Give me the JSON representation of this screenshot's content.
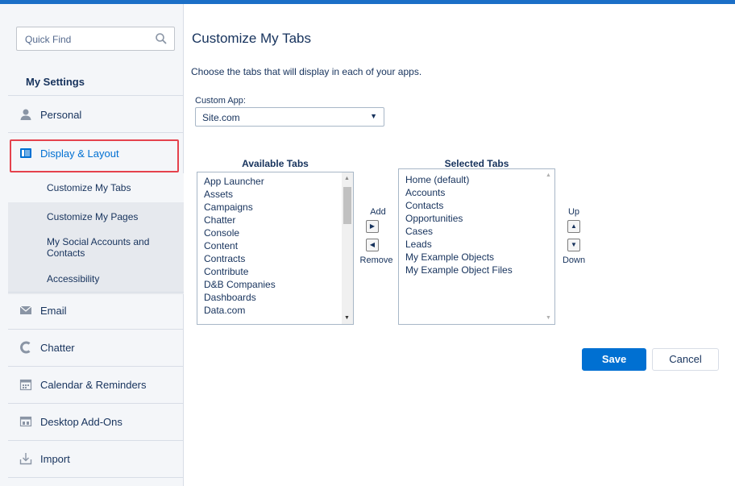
{
  "sidebar": {
    "quick_find_placeholder": "Quick Find",
    "title": "My Settings",
    "items": [
      {
        "label": "Personal",
        "icon": "user-icon"
      },
      {
        "label": "Display & Layout",
        "icon": "layout-icon"
      },
      {
        "label": "Email",
        "icon": "envelope-icon"
      },
      {
        "label": "Chatter",
        "icon": "chatter-icon"
      },
      {
        "label": "Calendar & Reminders",
        "icon": "calendar-icon"
      },
      {
        "label": "Desktop Add-Ons",
        "icon": "desktop-addons-icon"
      },
      {
        "label": "Import",
        "icon": "import-icon"
      }
    ],
    "sub_items": [
      {
        "label": "Customize My Tabs"
      },
      {
        "label": "Customize My Pages"
      },
      {
        "label": "My Social Accounts and Contacts"
      },
      {
        "label": "Accessibility"
      }
    ]
  },
  "main": {
    "title": "Customize My Tabs",
    "description": "Choose the tabs that will display in each of your apps.",
    "custom_app_label": "Custom App:",
    "custom_app_value": "Site.com",
    "available_title": "Available Tabs",
    "available_tabs": [
      "App Launcher",
      "Assets",
      "Campaigns",
      "Chatter",
      "Console",
      "Content",
      "Contracts",
      "Contribute",
      "D&B Companies",
      "Dashboards",
      "Data.com"
    ],
    "selected_title": "Selected Tabs",
    "selected_tabs": [
      "Home (default)",
      "Accounts",
      "Contacts",
      "Opportunities",
      "Cases",
      "Leads",
      "My Example Objects",
      "My Example Object Files"
    ],
    "add_label": "Add",
    "remove_label": "Remove",
    "up_label": "Up",
    "down_label": "Down",
    "save_label": "Save",
    "cancel_label": "Cancel"
  },
  "colors": {
    "accent": "#0070d2",
    "highlight_border": "#e5424d",
    "topbar": "#1b6fc7"
  }
}
